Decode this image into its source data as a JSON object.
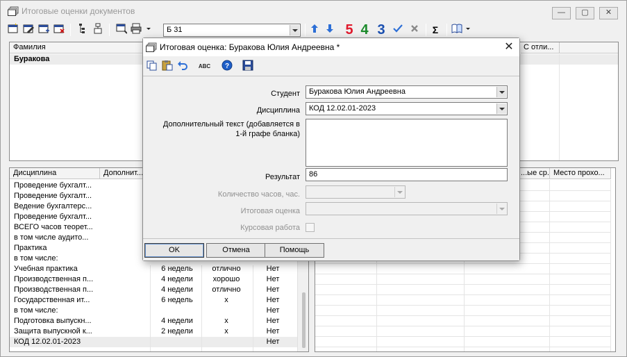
{
  "main_window": {
    "title": "Итоговые оценки документов",
    "controls": {
      "minimize": "—",
      "maximize": "▢",
      "close": "✕"
    }
  },
  "toolbar": {
    "document_combo_value": "Б 31",
    "grade_buttons": [
      {
        "label": "5",
        "color": "#e0192c"
      },
      {
        "label": "4",
        "color": "#1a8a2a"
      },
      {
        "label": "3",
        "color": "#1a4fb0"
      }
    ],
    "sum_label": "Σ"
  },
  "students_grid": {
    "columns": [
      "Фамилия",
      "С отли..."
    ],
    "rows": [
      [
        "Буракова"
      ]
    ]
  },
  "disciplines_grid": {
    "columns": [
      "Дисциплина",
      "Дополнит..."
    ],
    "right_columns": [
      "...ые ср...",
      "Место прохо..."
    ],
    "rows": [
      {
        "name": "Проведение бухгалт...",
        "hours": "",
        "grade": "",
        "course": ""
      },
      {
        "name": "Проведение бухгалт...",
        "hours": "",
        "grade": "",
        "course": ""
      },
      {
        "name": "Ведение бухгалтерс...",
        "hours": "",
        "grade": "",
        "course": ""
      },
      {
        "name": "Проведение бухгалт...",
        "hours": "",
        "grade": "",
        "course": ""
      },
      {
        "name": "ВСЕГО часов теорет...",
        "hours": "",
        "grade": "",
        "course": ""
      },
      {
        "name": "в том числе аудито...",
        "hours": "",
        "grade": "",
        "course": ""
      },
      {
        "name": "Практика",
        "hours": "",
        "grade": "",
        "course": ""
      },
      {
        "name": "в том числе:",
        "hours": "",
        "grade": "",
        "course": ""
      },
      {
        "name": "Учебная практика",
        "hours": "6 недель",
        "grade": "отлично",
        "course": "Нет"
      },
      {
        "name": "Производственная п...",
        "hours": "4 недели",
        "grade": "хорошо",
        "course": "Нет"
      },
      {
        "name": "Производственная п...",
        "hours": "4 недели",
        "grade": "отлично",
        "course": "Нет"
      },
      {
        "name": "Государственная ит...",
        "hours": "6 недель",
        "grade": "х",
        "course": "Нет"
      },
      {
        "name": "в том числе:",
        "hours": "",
        "grade": "",
        "course": "Нет"
      },
      {
        "name": "Подготовка выпускн...",
        "hours": "4 недели",
        "grade": "х",
        "course": "Нет"
      },
      {
        "name": "Защита выпускной к...",
        "hours": "2 недели",
        "grade": "х",
        "course": "Нет"
      },
      {
        "name": "КОД 12.02.01-2023",
        "hours": "",
        "grade": "",
        "course": "Нет"
      }
    ]
  },
  "dialog": {
    "title": "Итоговая оценка: Буракова Юлия Андреевна *",
    "close": "✕",
    "fields": {
      "student_label": "Студент",
      "student_value": "Буракова Юлия Андреевна",
      "discipline_label": "Дисциплина",
      "discipline_value": "КОД 12.02.01-2023",
      "extra_text_label_line1": "Дополнительный текст (добавляется в",
      "extra_text_label_line2": "1-й графе бланка)",
      "extra_text_value": "",
      "result_label": "Результат",
      "result_value": "86",
      "hours_label": "Количество часов, час.",
      "hours_value": "",
      "final_grade_label": "Итоговая оценка",
      "final_grade_value": "",
      "coursework_label": "Курсовая работа"
    },
    "spellcheck_label": "ABC",
    "help_icon_label": "?",
    "buttons": {
      "ok": "OK",
      "cancel": "Отмена",
      "help": "Помощь"
    }
  }
}
